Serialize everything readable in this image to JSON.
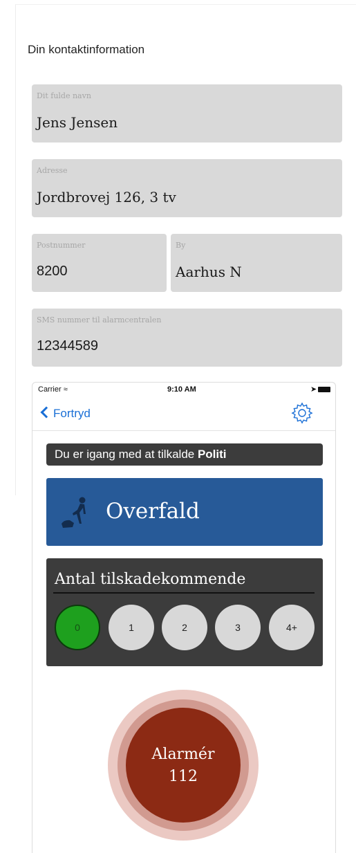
{
  "contact": {
    "title": "Din kontaktinformation",
    "name_label": "Dit fulde navn",
    "name_value": "Jens Jensen",
    "address_label": "Adresse",
    "address_value": "Jordbrovej 126, 3 tv",
    "zip_label": "Postnummer",
    "zip_value": "8200",
    "city_label": "By",
    "city_value": "Aarhus N",
    "sms_label": "SMS nummer til alarmcentralen",
    "sms_value": "12344589"
  },
  "statusbar": {
    "carrier": "Carrier",
    "time": "9:10 AM"
  },
  "nav": {
    "back_label": "Fortryd",
    "settings_icon": "gear-icon"
  },
  "banner": {
    "prefix": "Du er igang med at tilkalde ",
    "service": "Politi"
  },
  "incident": {
    "label": "Overfald",
    "icon": "assault-icon"
  },
  "injured": {
    "title": "Antal tilskadekommende",
    "options": [
      "0",
      "1",
      "2",
      "3",
      "4+"
    ],
    "selected_index": 0
  },
  "alarm": {
    "line1": "Alarmér",
    "line2": "112"
  },
  "colors": {
    "field_bg": "#d9d9d9",
    "incident_bg": "#275a98",
    "panel_bg": "#3c3c3c",
    "selected_green": "#1ea01e",
    "alarm_red": "#8c2a14",
    "ios_blue": "#1a6fd6"
  }
}
